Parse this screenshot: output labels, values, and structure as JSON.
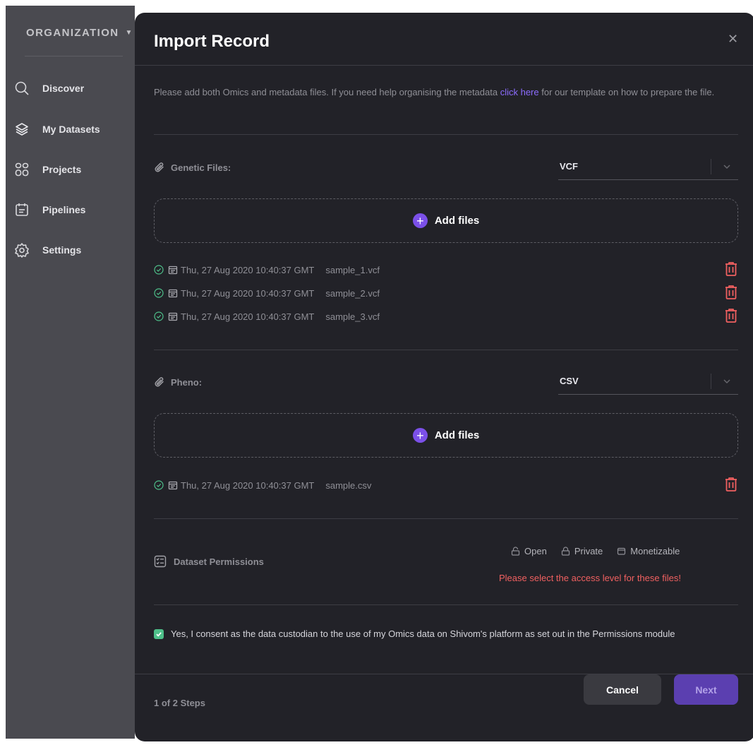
{
  "sidebar": {
    "org_label": "ORGANIZATION",
    "items": [
      {
        "label": "Discover",
        "icon": "search-icon"
      },
      {
        "label": "My Datasets",
        "icon": "layers-icon"
      },
      {
        "label": "Projects",
        "icon": "grid-icon"
      },
      {
        "label": "Pipelines",
        "icon": "calendar-icon"
      },
      {
        "label": "Settings",
        "icon": "gear-icon"
      }
    ]
  },
  "modal": {
    "title": "Import Record",
    "intro_before": "Please add both Omics and metadata files. If you need help organising the metadata ",
    "intro_link": "click here",
    "intro_after": " for our template on how to prepare the file.",
    "genetic": {
      "label": "Genetic Files:",
      "format": "VCF",
      "add_label": "Add files",
      "files": [
        {
          "date": "Thu, 27 Aug 2020 10:40:37 GMT",
          "name": "sample_1.vcf"
        },
        {
          "date": "Thu, 27 Aug 2020 10:40:37 GMT",
          "name": "sample_2.vcf"
        },
        {
          "date": "Thu, 27 Aug 2020 10:40:37 GMT",
          "name": "sample_3.vcf"
        }
      ]
    },
    "pheno": {
      "label": "Pheno:",
      "format": "CSV",
      "add_label": "Add files",
      "files": [
        {
          "date": "Thu, 27 Aug 2020 10:40:37 GMT",
          "name": "sample.csv"
        }
      ]
    },
    "permissions": {
      "label": "Dataset Permissions",
      "options": [
        "Open",
        "Private",
        "Monetizable"
      ],
      "error": "Please select the access level for these files!"
    },
    "consent": {
      "checked": true,
      "text": "Yes, I consent as the data custodian to the use of my Omics data on Shivom's platform as set out in the Permissions module"
    },
    "footer": {
      "steps": "1 of 2 Steps",
      "cancel": "Cancel",
      "next": "Next"
    }
  },
  "colors": {
    "accent": "#7b50e8",
    "link": "#8c6cff",
    "danger": "#f06060",
    "success": "#4ec08a"
  }
}
